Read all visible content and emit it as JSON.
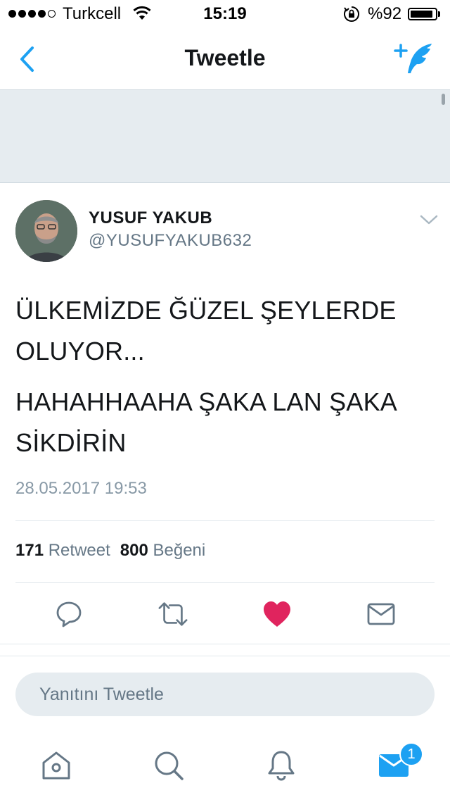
{
  "status_bar": {
    "carrier": "Turkcell",
    "time": "15:19",
    "battery_percent": "%92",
    "battery_level": 0.92,
    "signal_bars_filled": 4,
    "signal_bars_total": 5
  },
  "nav": {
    "title": "Tweetle",
    "back_icon": "chevron-left-icon",
    "compose_icon": "compose-feather-icon",
    "accent_color": "#1da1f2"
  },
  "tweet": {
    "display_name": "YUSUF YAKUB",
    "handle": "@YUSUFYAKUB632",
    "paragraphs": [
      "ÜLKEMİZDE ĞÜZEL ŞEYLERDE OLUYOR...",
      "HAHAHHAAHA ŞAKA LAN ŞAKA SİKDİRİN"
    ],
    "timestamp": "28.05.2017 19:53",
    "retweet_count": "171",
    "retweet_label": "Retweet",
    "like_count": "800",
    "like_label": "Beğeni",
    "liked": true,
    "like_color": "#e0245e"
  },
  "actions": [
    "reply-icon",
    "retweet-icon",
    "like-heart-icon",
    "direct-message-icon"
  ],
  "reply": {
    "placeholder": "Yanıtını Tweetle"
  },
  "tab_bar": {
    "tabs": [
      "home-icon",
      "search-icon",
      "notifications-icon",
      "messages-icon"
    ],
    "active_tab": "messages",
    "messages_badge": "1"
  }
}
